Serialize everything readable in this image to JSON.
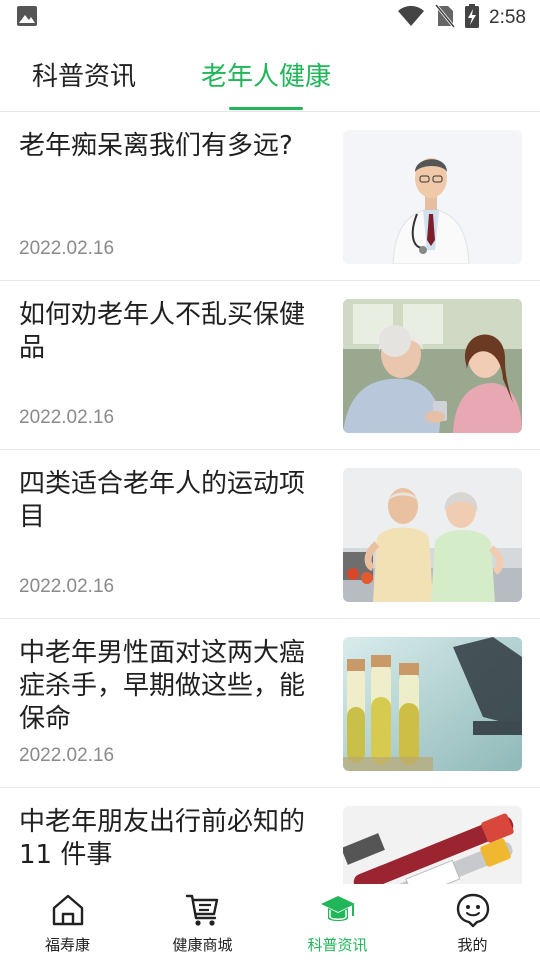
{
  "status_bar": {
    "time": "2:58",
    "icons": [
      "image-icon",
      "wifi-icon",
      "no-sim-icon",
      "battery-charging-icon"
    ]
  },
  "tabs": [
    {
      "label": "科普资讯",
      "active": false
    },
    {
      "label": "老年人健康",
      "active": true
    }
  ],
  "news": [
    {
      "title": "老年痴呆离我们有多远?",
      "date": "2022.02.16",
      "image": "doctor-photo"
    },
    {
      "title": "如何劝老年人不乱买保健品",
      "date": "2022.02.16",
      "image": "elderly-woman-with-caregiver-photo"
    },
    {
      "title": "四类适合老年人的运动项目",
      "date": "2022.02.16",
      "image": "elderly-couple-exercising-photo"
    },
    {
      "title": "中老年男性面对这两大癌症杀手，早期做这些，能保命",
      "date": "2022.02.16",
      "image": "test-tubes-microscope-photo"
    },
    {
      "title": "中老年朋友出行前必知的11 件事",
      "date": "",
      "image": "blood-test-tubes-photo"
    }
  ],
  "bottom_nav": [
    {
      "label": "福寿康",
      "icon": "home-icon",
      "active": false
    },
    {
      "label": "健康商城",
      "icon": "cart-icon",
      "active": false
    },
    {
      "label": "科普资讯",
      "icon": "graduation-cap-icon",
      "active": true
    },
    {
      "label": "我的",
      "icon": "chat-face-icon",
      "active": false
    }
  ],
  "colors": {
    "accent": "#21b659",
    "text": "#1f1f1f",
    "date": "#8a8a8a",
    "divider": "#e8e8e8"
  }
}
